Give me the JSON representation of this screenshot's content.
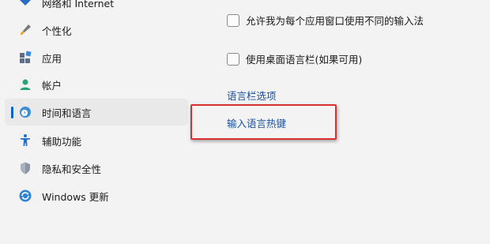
{
  "sidebar": {
    "items": [
      {
        "label": "网络和 Internet",
        "icon": "network-icon"
      },
      {
        "label": "个性化",
        "icon": "personalization-brush-icon"
      },
      {
        "label": "应用",
        "icon": "apps-icon"
      },
      {
        "label": "帐户",
        "icon": "account-person-icon"
      },
      {
        "label": "时间和语言",
        "icon": "time-language-icon",
        "selected": true
      },
      {
        "label": "辅助功能",
        "icon": "accessibility-icon"
      },
      {
        "label": "隐私和安全性",
        "icon": "privacy-shield-icon"
      },
      {
        "label": "Windows 更新",
        "icon": "windows-update-icon"
      }
    ]
  },
  "content": {
    "options": [
      {
        "label": "允许我为每个应用窗口使用不同的输入法",
        "checked": false
      },
      {
        "label": "使用桌面语言栏(如果可用)",
        "checked": false
      }
    ],
    "links": [
      {
        "label": "语言栏选项"
      },
      {
        "label": "输入语言热键"
      }
    ]
  },
  "colors": {
    "accent": "#0067c0",
    "link": "#1a4f9c",
    "highlight_border": "#d9302f",
    "background": "#f3f3f3"
  }
}
